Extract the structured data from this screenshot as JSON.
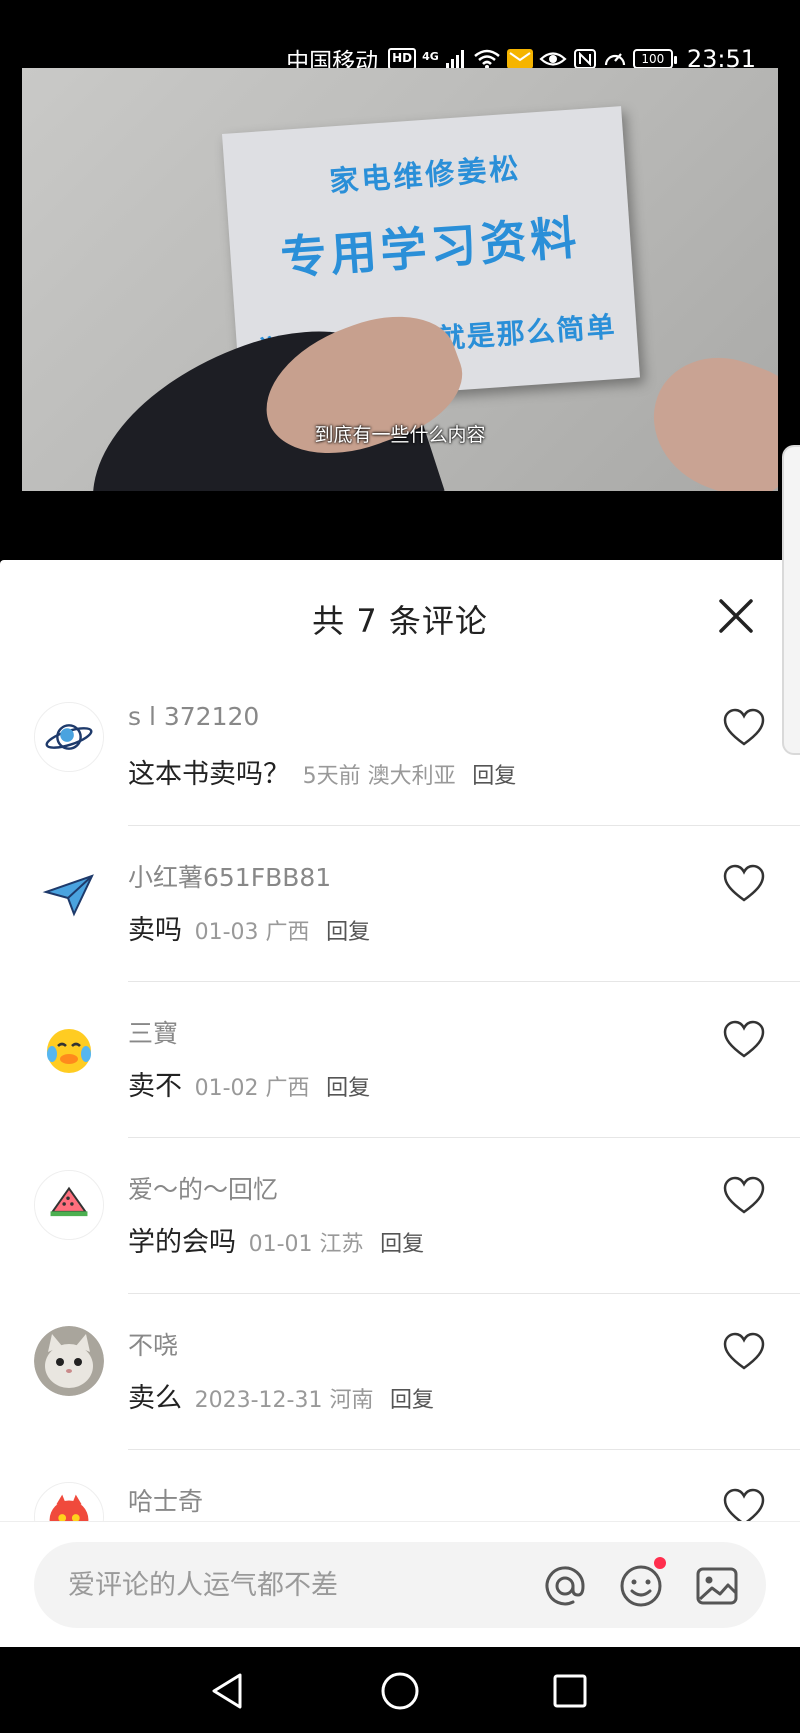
{
  "status_bar": {
    "carrier": "中国移动",
    "hd": "HD",
    "network": "4G",
    "battery": "100",
    "time": "23:51"
  },
  "video": {
    "book_line1": "家电维修姜松",
    "book_line2": "专用学习资料",
    "book_line3": "学习家电维修就是那么简单",
    "subtitle": "到底有一些什么内容"
  },
  "comments_panel": {
    "title": "共 7 条评论",
    "close_icon": "close-icon",
    "comments": [
      {
        "user": "s l 372120",
        "text": "这本书卖吗？",
        "meta": "5天前  澳大利亚",
        "reply": "回复",
        "avatar": "planet-avatar"
      },
      {
        "user": "小红薯651FBB81",
        "text": "卖吗",
        "meta": "01-03 广西",
        "reply": "回复",
        "avatar": "paper-plane-avatar"
      },
      {
        "user": "三寶",
        "text": "卖不",
        "meta": "01-02 广西",
        "reply": "回复",
        "avatar": "duck-emoji-avatar"
      },
      {
        "user": "爱～的～回忆",
        "text": "学的会吗",
        "meta": "01-01 江苏",
        "reply": "回复",
        "avatar": "watermelon-avatar"
      },
      {
        "user": "不哓",
        "text": "卖么",
        "meta": "2023-12-31 河南",
        "reply": "回复",
        "avatar": "cat-avatar"
      },
      {
        "user": "哈士奇",
        "text": "",
        "meta": "",
        "reply": "",
        "avatar": "red-monster-avatar"
      }
    ]
  },
  "input_bar": {
    "placeholder": "爱评论的人运气都不差",
    "icons": [
      "at-icon",
      "emoji-icon",
      "image-icon"
    ],
    "notify_color": "#ff2e4d"
  },
  "nav_bar": {
    "icons": [
      "back-triangle-icon",
      "home-circle-icon",
      "recents-square-icon"
    ]
  }
}
